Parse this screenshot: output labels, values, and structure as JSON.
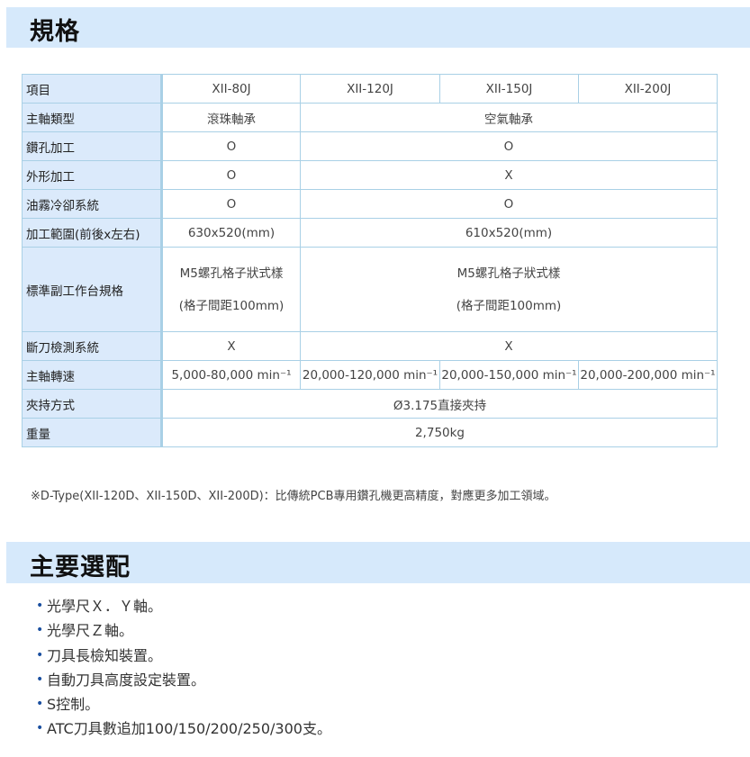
{
  "spec_section": {
    "title": "規格"
  },
  "spec_table": {
    "header": {
      "label": "項目",
      "models": [
        "XII-80J",
        "XII-120J",
        "XII-150J",
        "XII-200J"
      ]
    },
    "rows": [
      {
        "label": "主軸類型",
        "col1": "滾珠軸承",
        "rest": "空氣軸承"
      },
      {
        "label": "鑽孔加工",
        "col1": "O",
        "rest": "O"
      },
      {
        "label": "外形加工",
        "col1": "O",
        "rest": "X"
      },
      {
        "label": "油霧冷卻系統",
        "col1": "O",
        "rest": "O"
      },
      {
        "label": "加工範圍(前後x左右)",
        "col1": "630x520(mm)",
        "rest": "610x520(mm)"
      },
      {
        "label": "標準副工作台規格",
        "col1_line1": "M5螺孔格子狀式樣",
        "col1_line2": "(格子間距100mm)",
        "rest_line1": "M5螺孔格子狀式樣",
        "rest_line2": "(格子間距100mm)"
      },
      {
        "label": "斷刀檢測系統",
        "col1": "X",
        "rest": "X"
      },
      {
        "label": "主軸轉速",
        "values": [
          "5,000-80,000 min⁻¹",
          "20,000-120,000 min⁻¹",
          "20,000-150,000 min⁻¹",
          "20,000-200,000 min⁻¹"
        ]
      },
      {
        "label": "夾持方式",
        "all": "Ø3.175直接夾持"
      },
      {
        "label": "重量",
        "all": "2,750kg"
      }
    ]
  },
  "note": "※D-Type(XII-120D、XII-150D、XII-200D)：比傳統PCB專用鑽孔機更高精度，對應更多加工領域。",
  "options_section": {
    "title": "主要選配",
    "bullet": "•",
    "items": [
      "光學尺Ｘ．Ｙ軸。",
      "光學尺Ｚ軸。",
      "刀具長檢知裝置。",
      "自動刀具高度設定裝置。",
      "S控制。",
      "ATC刀具數追加100/150/200/250/300支。"
    ]
  },
  "colors": {
    "header_bg": "#d6e9fb",
    "label_bg": "#dbeafb",
    "border": "#a9d0e6",
    "bullet": "#1a4fa0"
  }
}
